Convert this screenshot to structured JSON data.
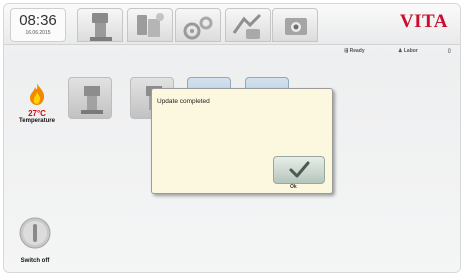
{
  "header": {
    "clock": {
      "time": "08:36",
      "date": "16.06.2015"
    },
    "tabs": [
      {
        "id": "tab-furnace",
        "icon": "furnace-icon"
      },
      {
        "id": "tab-programs",
        "icon": "programs-icon"
      },
      {
        "id": "tab-settings",
        "icon": "settings-icon"
      },
      {
        "id": "tab-service",
        "icon": "service-icon"
      },
      {
        "id": "tab-photo",
        "icon": "camera-icon"
      }
    ],
    "logo": "VITA"
  },
  "status_bar": {
    "state": "Ready",
    "user": "Labor"
  },
  "left_panel": {
    "temperature": {
      "value": "27°C",
      "label": "Temperature",
      "icon": "flame-icon"
    },
    "switch_off": {
      "label": "Switch off",
      "icon": "power-icon"
    }
  },
  "dialog": {
    "message": "Update completed",
    "ok_label": "Ok",
    "ok_icon": "checkmark-icon"
  },
  "colors": {
    "brand": "#c8102e",
    "temperature": "#d00a0a",
    "dialog_bg": "#fcf8e0",
    "selected_program": "#a8c2d8"
  }
}
